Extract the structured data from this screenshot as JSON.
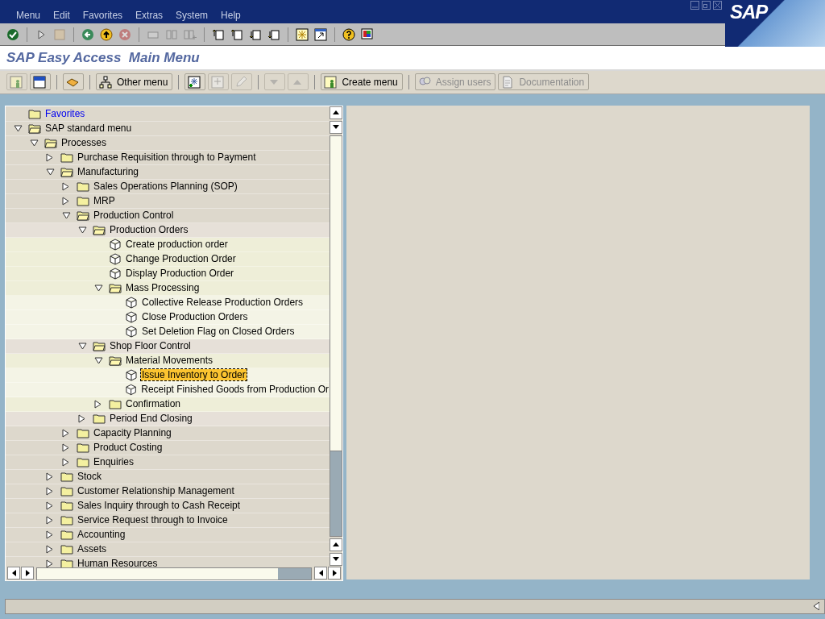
{
  "window": {
    "logo": "SAP"
  },
  "menu_bar": [
    "Menu",
    "Edit",
    "Favorites",
    "Extras",
    "System",
    "Help"
  ],
  "standard_toolbar": [
    {
      "kind": "enter",
      "disabled": false
    },
    {
      "kind": "sep"
    },
    {
      "kind": "command",
      "disabled": false
    },
    {
      "kind": "save",
      "disabled": true
    },
    {
      "kind": "sep"
    },
    {
      "kind": "back",
      "disabled": false
    },
    {
      "kind": "exit",
      "disabled": false
    },
    {
      "kind": "cancel",
      "disabled": true
    },
    {
      "kind": "sep"
    },
    {
      "kind": "print",
      "disabled": true
    },
    {
      "kind": "find",
      "disabled": true
    },
    {
      "kind": "findnext",
      "disabled": true
    },
    {
      "kind": "sep"
    },
    {
      "kind": "first",
      "disabled": false
    },
    {
      "kind": "prev",
      "disabled": false
    },
    {
      "kind": "next",
      "disabled": false
    },
    {
      "kind": "last",
      "disabled": false
    },
    {
      "kind": "sep"
    },
    {
      "kind": "session",
      "disabled": false
    },
    {
      "kind": "shortcut",
      "disabled": false
    },
    {
      "kind": "sep"
    },
    {
      "kind": "help",
      "disabled": false
    },
    {
      "kind": "layout",
      "disabled": false
    }
  ],
  "screen_title": "SAP Easy Access  Main Menu",
  "app_toolbar": [
    {
      "kind": "user",
      "disabled": true
    },
    {
      "kind": "sapmenu",
      "disabled": false
    },
    {
      "kind": "sep"
    },
    {
      "kind": "favbox",
      "disabled": false
    },
    {
      "kind": "sep"
    },
    {
      "kind": "hierarchy",
      "label": "Other menu",
      "disabled": false
    },
    {
      "kind": "sep"
    },
    {
      "kind": "addfav",
      "disabled": false
    },
    {
      "kind": "delfav",
      "disabled": true
    },
    {
      "kind": "pencil",
      "disabled": true
    },
    {
      "kind": "sep"
    },
    {
      "kind": "down",
      "disabled": true
    },
    {
      "kind": "up",
      "disabled": true
    },
    {
      "kind": "sep"
    },
    {
      "kind": "user",
      "label": "Create menu",
      "disabled": false
    },
    {
      "kind": "sep"
    },
    {
      "kind": "users",
      "label": "Assign users",
      "disabled": true
    },
    {
      "kind": "doc",
      "label": "Documentation",
      "disabled": true
    }
  ],
  "tree": [
    {
      "kind": "favorites",
      "label": "Favorites"
    },
    {
      "kind": "folder",
      "label": "SAP standard menu",
      "expanded": true,
      "children": [
        {
          "kind": "folder",
          "label": "Processes",
          "expanded": true,
          "children": [
            {
              "kind": "folder",
              "label": "Purchase Requisition through to Payment",
              "expanded": false
            },
            {
              "kind": "folder",
              "label": "Manufacturing",
              "expanded": true,
              "children": [
                {
                  "kind": "folder",
                  "label": "Sales Operations Planning (SOP)",
                  "expanded": false
                },
                {
                  "kind": "folder",
                  "label": "MRP",
                  "expanded": false
                },
                {
                  "kind": "folder",
                  "label": "Production Control",
                  "expanded": true,
                  "children": [
                    {
                      "kind": "folder",
                      "label": "Production Orders",
                      "expanded": true,
                      "children": [
                        {
                          "kind": "transaction",
                          "label": "Create production order",
                          "selected": false
                        },
                        {
                          "kind": "transaction",
                          "label": "Change Production Order",
                          "selected": false
                        },
                        {
                          "kind": "transaction",
                          "label": "Display Production Order",
                          "selected": false
                        },
                        {
                          "kind": "folder",
                          "label": "Mass Processing",
                          "expanded": true,
                          "children": [
                            {
                              "kind": "transaction",
                              "label": "Collective Release Production Orders",
                              "selected": false
                            },
                            {
                              "kind": "transaction",
                              "label": "Close Production Orders",
                              "selected": false
                            },
                            {
                              "kind": "transaction",
                              "label": "Set Deletion Flag on Closed Orders",
                              "selected": false
                            }
                          ]
                        }
                      ]
                    },
                    {
                      "kind": "folder",
                      "label": "Shop Floor Control",
                      "expanded": true,
                      "children": [
                        {
                          "kind": "folder",
                          "label": "Material Movements",
                          "expanded": true,
                          "children": [
                            {
                              "kind": "transaction",
                              "label": "Issue Inventory to Order",
                              "selected": true
                            },
                            {
                              "kind": "transaction",
                              "label": "Receipt Finished Goods from Production Or",
                              "selected": false
                            }
                          ]
                        },
                        {
                          "kind": "folder",
                          "label": "Confirmation",
                          "expanded": false
                        }
                      ]
                    },
                    {
                      "kind": "folder",
                      "label": "Period End Closing",
                      "expanded": false
                    }
                  ]
                },
                {
                  "kind": "folder",
                  "label": "Capacity Planning",
                  "expanded": false
                },
                {
                  "kind": "folder",
                  "label": "Product Costing",
                  "expanded": false
                },
                {
                  "kind": "folder",
                  "label": "Enquiries",
                  "expanded": false
                }
              ]
            },
            {
              "kind": "folder",
              "label": "Stock",
              "expanded": false
            },
            {
              "kind": "folder",
              "label": "Customer Relationship Management",
              "expanded": false
            },
            {
              "kind": "folder",
              "label": "Sales Inquiry through to Cash Receipt",
              "expanded": false
            },
            {
              "kind": "folder",
              "label": "Service Request through to Invoice",
              "expanded": false
            },
            {
              "kind": "folder",
              "label": "Accounting",
              "expanded": false
            },
            {
              "kind": "folder",
              "label": "Assets",
              "expanded": false
            },
            {
              "kind": "folder",
              "label": "Human Resources",
              "expanded": false
            }
          ]
        }
      ]
    }
  ]
}
